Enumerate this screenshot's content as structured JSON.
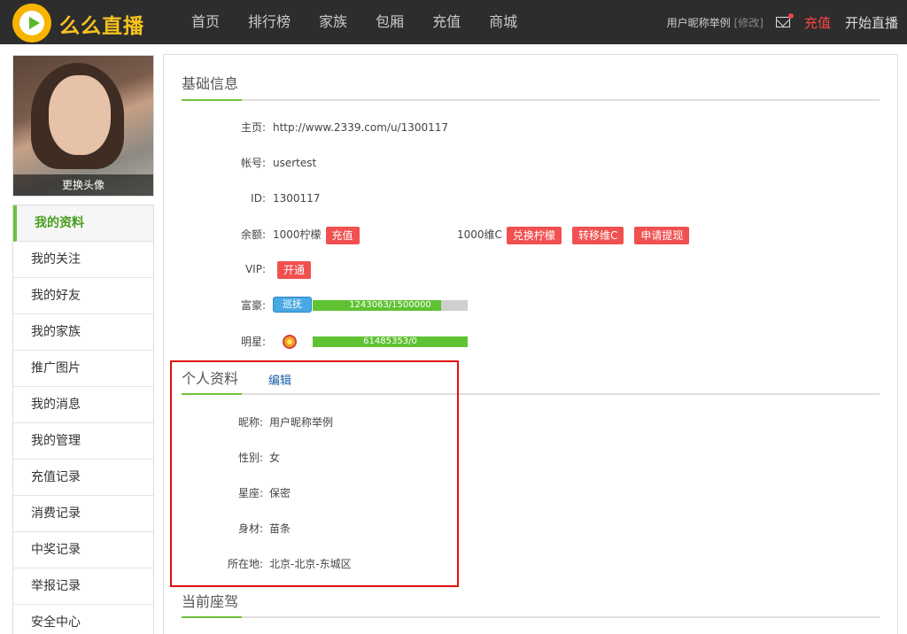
{
  "header": {
    "brand": "么么直播",
    "nav": [
      "首页",
      "排行榜",
      "家族",
      "包厢",
      "充值",
      "商城"
    ],
    "nickname": "用户昵称举例",
    "edit": "[修改]",
    "recharge": "充值",
    "start_live": "开始直播"
  },
  "sidebar": {
    "avatar_change": "更换头像",
    "items": [
      {
        "label": "我的资料",
        "active": true
      },
      {
        "label": "我的关注"
      },
      {
        "label": "我的好友"
      },
      {
        "label": "我的家族"
      },
      {
        "label": "推广图片"
      },
      {
        "label": "我的消息"
      },
      {
        "label": "我的管理"
      },
      {
        "label": "充值记录"
      },
      {
        "label": "消费记录"
      },
      {
        "label": "中奖记录"
      },
      {
        "label": "举报记录"
      },
      {
        "label": "安全中心"
      }
    ]
  },
  "basic": {
    "title": "基础信息",
    "homepage_label": "主页:",
    "homepage": "http://www.2339.com/u/1300117",
    "account_label": "帐号:",
    "account": "usertest",
    "id_label": "ID:",
    "id": "1300117",
    "balance_label": "余额:",
    "balance": "1000柠檬",
    "recharge_btn": "充值",
    "weic": "1000维C",
    "exchange_btn": "兑换柠檬",
    "transfer_btn": "转移维C",
    "withdraw_btn": "申请提现",
    "vip_label": "VIP:",
    "vip_btn": "开通",
    "rich_label": "富豪:",
    "rich_badge": "巡抚",
    "rich_progress_text": "1243063/1500000",
    "rich_progress_fraction": 0.83,
    "star_label": "明星:",
    "star_progress_text": "61485353/0",
    "star_progress_fraction": 1.0
  },
  "profile": {
    "title": "个人资料",
    "edit": "编辑",
    "nick_label": "昵称:",
    "nick": "用户昵称举例",
    "gender_label": "性别:",
    "gender": "女",
    "constellation_label": "星座:",
    "constellation": "保密",
    "body_label": "身材:",
    "body": "苗条",
    "location_label": "所在地:",
    "location": "北京-北京-东城区"
  },
  "current": {
    "title": "当前座驾"
  },
  "colors": {
    "accent_green": "#6cc13a",
    "button_red": "#f15050",
    "highlight_box": "#e01010",
    "topbar": "#2d2d2d"
  }
}
